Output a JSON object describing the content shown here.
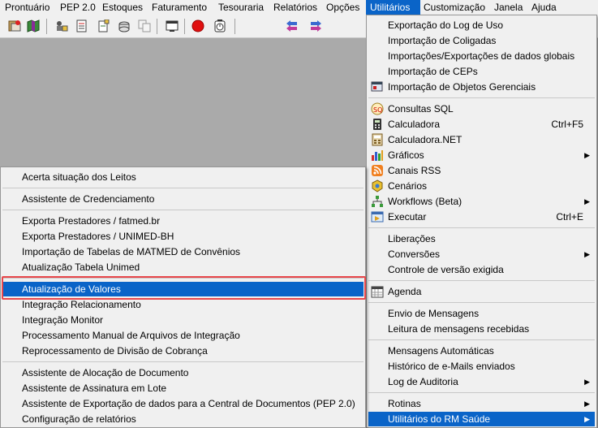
{
  "menubar": {
    "items": [
      "Prontuário",
      "PEP 2.0",
      "Estoques",
      "Faturamento",
      "Tesouraria",
      "Relatórios",
      "Opções",
      "Utilitários",
      "Customização",
      "Janela",
      "Ajuda"
    ],
    "active": "Utilitários"
  },
  "toolbar": {
    "icons": [
      "patient-records-icon",
      "map-icon",
      "users-settings-icon",
      "document-list-icon",
      "document-edit-icon",
      "stack-icon",
      "copy-icon",
      "window-icon",
      "stop-record-icon",
      "clock-icon",
      "back-arrows-icon",
      "forward-arrows-icon"
    ]
  },
  "utilitarios_menu": {
    "items": [
      {
        "label": "Exportação do Log de Uso"
      },
      {
        "label": "Importação de Coligadas"
      },
      {
        "label": "Importações/Exportações de dados globais"
      },
      {
        "label": "Importação de CEPs"
      },
      {
        "label": "Importação de Objetos Gerenciais",
        "icon": "objects-icon"
      },
      {
        "label": "Consultas SQL",
        "icon": "sql-icon"
      },
      {
        "label": "Calculadora",
        "icon": "calculator-icon",
        "shortcut": "Ctrl+F5"
      },
      {
        "label": "Calculadora.NET",
        "icon": "calculator-net-icon"
      },
      {
        "label": "Gráficos",
        "icon": "chart-icon",
        "submenu": true
      },
      {
        "label": "Canais RSS",
        "icon": "rss-icon"
      },
      {
        "label": "Cenários",
        "icon": "scenarios-icon"
      },
      {
        "label": "Workflows (Beta)",
        "icon": "workflow-icon",
        "submenu": true
      },
      {
        "label": "Executar",
        "icon": "execute-icon",
        "shortcut": "Ctrl+E"
      },
      {
        "label": "Liberações"
      },
      {
        "label": "Conversões",
        "submenu": true
      },
      {
        "label": "Controle de versão exigida"
      },
      {
        "label": "Agenda",
        "icon": "agenda-icon"
      },
      {
        "label": "Envio de Mensagens"
      },
      {
        "label": "Leitura de mensagens recebidas"
      },
      {
        "label": "Mensagens Automáticas"
      },
      {
        "label": "Histórico de e-Mails enviados"
      },
      {
        "label": "Log de Auditoria",
        "submenu": true
      },
      {
        "label": "Rotinas",
        "submenu": true
      },
      {
        "label": "Utilitários do RM Saúde",
        "submenu": true,
        "highlighted": true
      }
    ]
  },
  "rm_saude_submenu": {
    "items": [
      {
        "label": "Acerta situação dos Leitos"
      },
      {
        "label": "Assistente de Credenciamento"
      },
      {
        "label": "Exporta Prestadores / fatmed.br"
      },
      {
        "label": "Exporta Prestadores / UNIMED-BH"
      },
      {
        "label": "Importação de Tabelas de MATMED de Convênios"
      },
      {
        "label": "Atualização Tabela Unimed"
      },
      {
        "label": "Atualização de Valores",
        "highlighted": true
      },
      {
        "label": "Integração Relacionamento"
      },
      {
        "label": "Integração Monitor"
      },
      {
        "label": "Processamento Manual de Arquivos de Integração"
      },
      {
        "label": "Reprocessamento de Divisão de Cobrança"
      },
      {
        "label": "Assistente de Alocação de Documento"
      },
      {
        "label": "Assistente de Assinatura em Lote"
      },
      {
        "label": "Assistente de Exportação de dados para a Central de Documentos (PEP 2.0)"
      },
      {
        "label": "Configuração de relatórios"
      }
    ]
  },
  "colors": {
    "highlight": "#0a64c8",
    "annotation_border": "#e8474b",
    "menu_bg": "#f0f0f0",
    "workspace_bg": "#aaaaaa"
  }
}
